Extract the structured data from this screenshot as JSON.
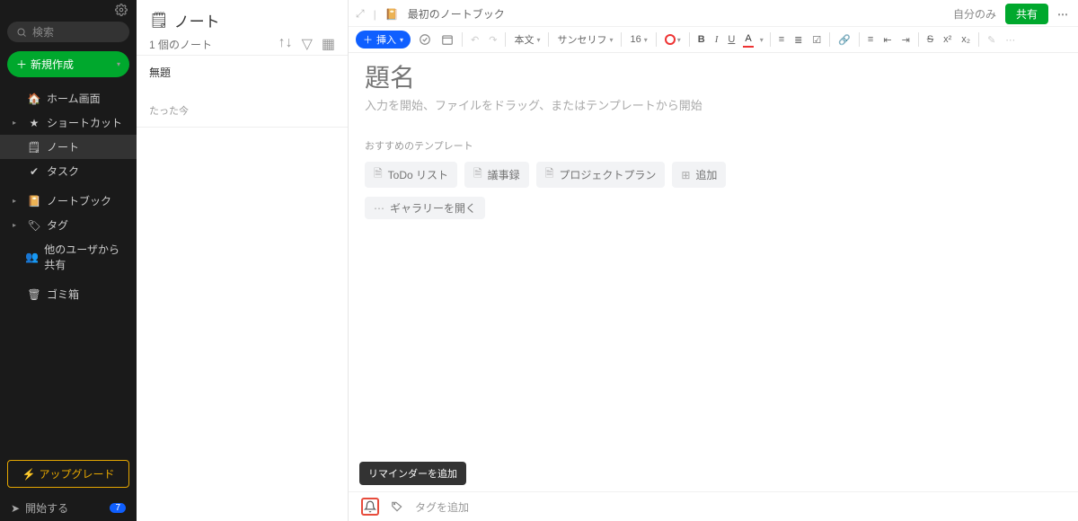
{
  "sidebar": {
    "search_placeholder": "検索",
    "new_button": "新規作成",
    "items": [
      {
        "label": "ホーム画面"
      },
      {
        "label": "ショートカット"
      },
      {
        "label": "ノート"
      },
      {
        "label": "タスク"
      },
      {
        "label": "ノートブック"
      },
      {
        "label": "タグ"
      },
      {
        "label": "他のユーザから共有"
      },
      {
        "label": "ゴミ箱"
      }
    ],
    "upgrade": "アップグレード",
    "start": "開始する",
    "badge": "7"
  },
  "notelist": {
    "title": "ノート",
    "count": "1 個のノート",
    "note": {
      "title": "無題",
      "date": "たった今"
    }
  },
  "editor": {
    "notebook": "最初のノートブック",
    "visibility": "自分のみ",
    "share": "共有",
    "toolbar": {
      "insert": "挿入",
      "body": "本文",
      "font": "サンセリフ",
      "size": "16",
      "bold": "B",
      "italic": "I",
      "underline": "U",
      "fontcolor": "A"
    },
    "title_placeholder": "題名",
    "body_placeholder": "入力を開始、ファイルをドラッグ、またはテンプレートから開始",
    "templates_header": "おすすめのテンプレート",
    "templates": [
      "ToDo リスト",
      "議事録",
      "プロジェクトプラン",
      "追加",
      "ギャラリーを開く"
    ],
    "footer": {
      "tooltip": "リマインダーを追加",
      "tag_placeholder": "タグを追加"
    }
  }
}
